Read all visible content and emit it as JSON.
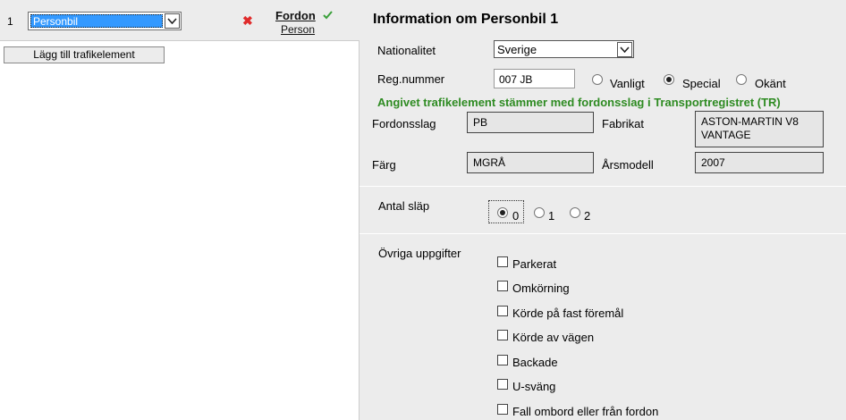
{
  "left": {
    "row_number": "1",
    "type_select_value": "Personbil",
    "fordon_link": "Fordon",
    "person_link": "Person",
    "add_button": "Lägg till trafikelement"
  },
  "info": {
    "title": "Information om Personbil 1",
    "nationalitet_label": "Nationalitet",
    "nationalitet_value": "Sverige",
    "regnummer_label": "Reg.nummer",
    "regnummer_value": "007 JB",
    "reg_types": [
      "Vanligt",
      "Special",
      "Okänt"
    ],
    "reg_type_selected": "Special",
    "tr_message": "Angivet trafikelement stämmer med fordonsslag i Transportregistret (TR)",
    "fordonsslag_label": "Fordonsslag",
    "fordonsslag_value": "PB",
    "fabrikat_label": "Fabrikat",
    "fabrikat_value_line1": "ASTON-MARTIN V8",
    "fabrikat_value_line2": "VANTAGE",
    "farg_label": "Färg",
    "farg_value": "MGRÅ",
    "arsmodell_label": "Årsmodell",
    "arsmodell_value": "2007"
  },
  "slap": {
    "label": "Antal släp",
    "options": [
      "0",
      "1",
      "2"
    ],
    "selected": "0"
  },
  "ovriga": {
    "label": "Övriga uppgifter",
    "items": [
      "Parkerat",
      "Omkörning",
      "Körde på fast föremål",
      "Körde av vägen",
      "Backade",
      "U-sväng",
      "Fall ombord eller från fordon"
    ]
  },
  "colors": {
    "accent_green": "#2e8b22",
    "select_highlight": "#3399ff",
    "remove_red": "#e02b2b",
    "panel_gray": "#ececec"
  }
}
